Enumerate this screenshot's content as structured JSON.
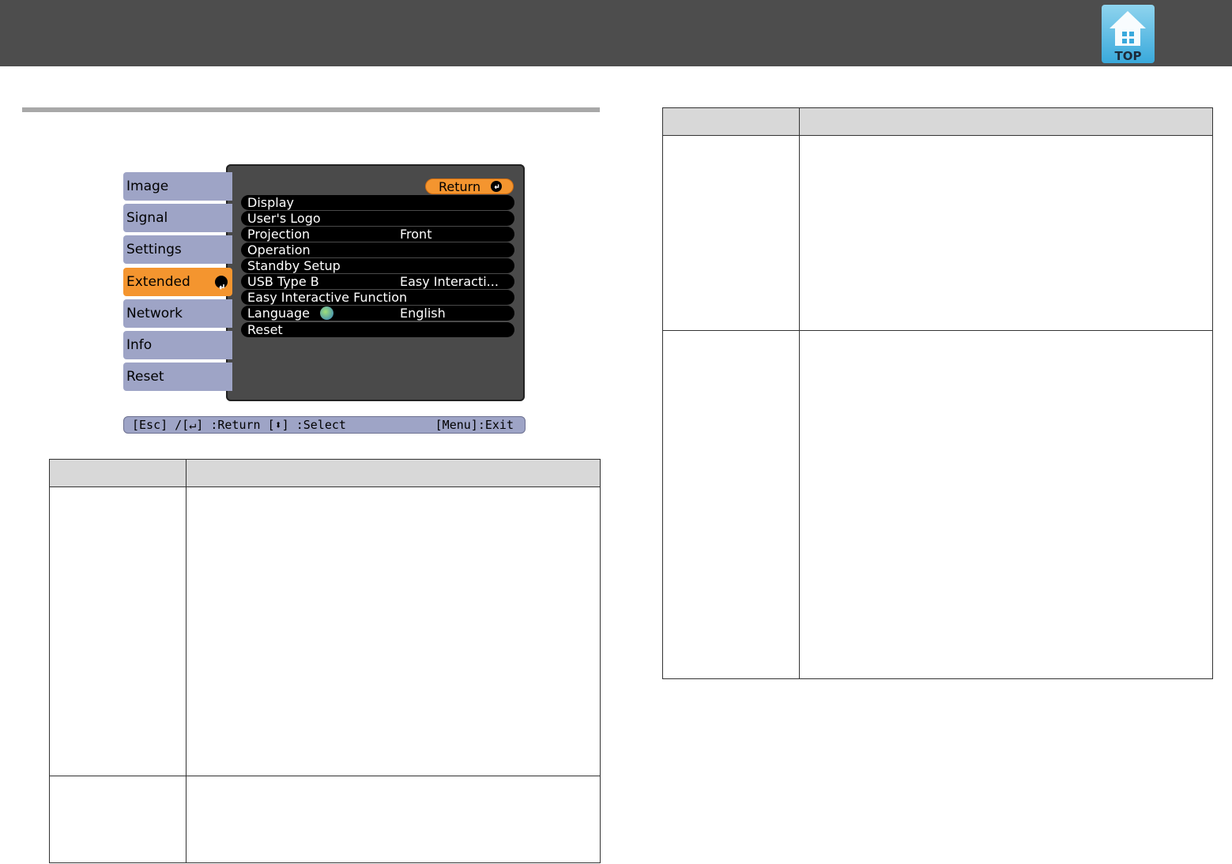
{
  "header": {
    "top_icon": {
      "icon": "house-top-icon",
      "label": "TOP"
    }
  },
  "projector_menu": {
    "tabs": [
      {
        "label": "Image"
      },
      {
        "label": "Signal"
      },
      {
        "label": "Settings"
      },
      {
        "label": "Extended",
        "active": true
      },
      {
        "label": "Network"
      },
      {
        "label": "Info"
      },
      {
        "label": "Reset"
      }
    ],
    "return_label": "Return",
    "items": [
      {
        "label": "Display",
        "value": ""
      },
      {
        "label": "User's Logo",
        "value": ""
      },
      {
        "label": "Projection",
        "value": "Front"
      },
      {
        "label": "Operation",
        "value": ""
      },
      {
        "label": "Standby Setup",
        "value": ""
      },
      {
        "label": "USB Type B",
        "value": "Easy Interacti..."
      },
      {
        "label": "Easy Interactive Function",
        "value": ""
      },
      {
        "label": "Language",
        "value": "English",
        "icon": "globe-icon"
      },
      {
        "label": "Reset",
        "value": ""
      }
    ],
    "footer": {
      "left": "[Esc] /[↵] :Return  [⬍] :Select",
      "right": "[Menu]:Exit"
    }
  },
  "colors": {
    "header_bar": "#4d4d4d",
    "tab_inactive": "#9ea4c6",
    "tab_active": "#f4952f",
    "panel": "#4a4a4a",
    "table_header": "#d8d8d8"
  }
}
